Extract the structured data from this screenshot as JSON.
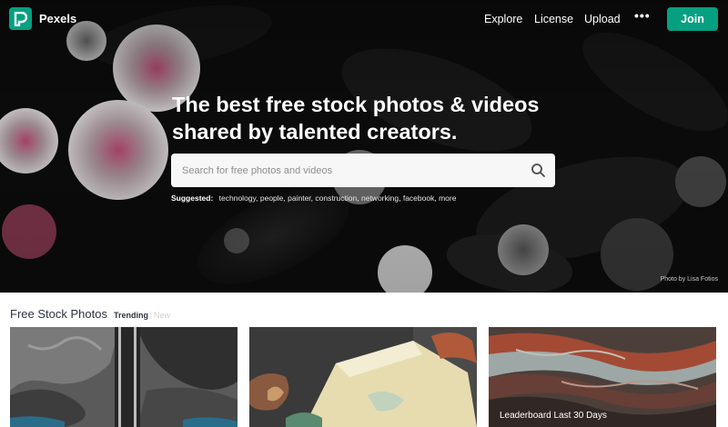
{
  "nav": {
    "brand": "Pexels",
    "links": [
      "Explore",
      "License",
      "Upload"
    ],
    "more": "•••",
    "join_label": "Join"
  },
  "hero": {
    "headline_line1": "The best free stock photos & videos",
    "headline_line2": "shared by talented creators.",
    "search_placeholder": "Search for free photos and videos",
    "suggested_label": "Suggested:",
    "suggested_tags": [
      "technology",
      "people",
      "painter",
      "construction",
      "networking",
      "facebook",
      "more"
    ],
    "credit": "Photo by Lisa Fotios"
  },
  "section": {
    "title": "Free Stock Photos",
    "tab_trending": "Trending",
    "tab_separator": "|",
    "tab_new": "New"
  },
  "photos": [
    {
      "label": ""
    },
    {
      "label": ""
    },
    {
      "label": "Leaderboard Last 30 Days"
    }
  ],
  "colors": {
    "brand": "#05a081",
    "hero_bg": "#0b0b0b",
    "search_bg": "#f7f7f7"
  },
  "icons": {
    "logo": "pexels-logo-icon",
    "search": "search-icon"
  }
}
